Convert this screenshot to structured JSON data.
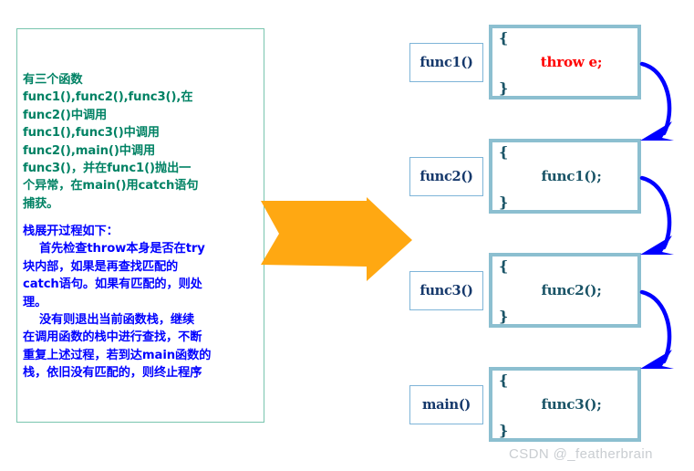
{
  "description_panel": {
    "paragraph_green": "有三个函数\nfunc1(),func2(),func3(),在\nfunc2()中调用\nfunc1(),func3()中调用\nfunc2(),main()中调用\nfunc3()，并在func1()抛出一\n个异常，在main()用catch语句\n捕获。",
    "paragraph_blue": "栈展开过程如下：\n    首先检查throw本身是否在try\n块内部，如果是再查找匹配的\ncatch语句。如果有匹配的，则处\n理。\n    没有则退出当前函数栈，继续\n在调用函数的栈中进行查找，不断\n重复上述过程，若到达main函数的\n栈，依旧没有匹配的，则终止程序",
    "border_color": "#79c5ae",
    "green_text_color": "#008264",
    "blue_text_color": "#0000ff"
  },
  "flow_arrow": {
    "icon": "orange-right-arrow-icon",
    "color": "#ffa812"
  },
  "call_stack": {
    "frames": [
      {
        "label": "func1()",
        "open_brace": "{",
        "statement": "throw e;",
        "close_brace": "}",
        "statement_is_throw": true
      },
      {
        "label": "func2()",
        "open_brace": "{",
        "statement": "func1();",
        "close_brace": "}",
        "statement_is_throw": false
      },
      {
        "label": "func3()",
        "open_brace": "{",
        "statement": "func2();",
        "close_brace": "}",
        "statement_is_throw": false
      },
      {
        "label": "main()",
        "open_brace": "{",
        "statement": "func3();",
        "close_brace": "}",
        "statement_is_throw": false
      }
    ],
    "label_border_color": "#7eb4d8",
    "label_text_color": "#15386b",
    "code_border_color": "#8cbfd0",
    "code_text_color": "#1a5467",
    "throw_text_color": "#ff0000",
    "unwind_arrow_color": "#0000ff",
    "unwind_arrow_count": 3
  },
  "watermark": {
    "text": "CSDN @_featherbrain",
    "color": "#c9cdd1"
  }
}
